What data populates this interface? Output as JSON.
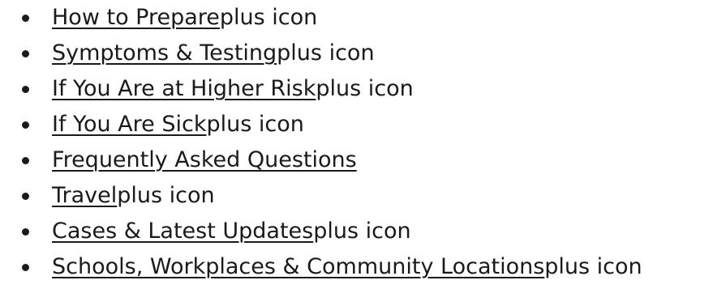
{
  "nav": {
    "items": [
      {
        "label": "How to Prepare",
        "suffix": "plus icon"
      },
      {
        "label": "Symptoms & Testing",
        "suffix": "plus icon"
      },
      {
        "label": "If You Are at Higher Risk",
        "suffix": "plus icon"
      },
      {
        "label": "If You Are Sick",
        "suffix": "plus icon"
      },
      {
        "label": "Frequently Asked Questions",
        "suffix": ""
      },
      {
        "label": "Travel",
        "suffix": "plus icon"
      },
      {
        "label": "Cases & Latest Updates",
        "suffix": "plus icon"
      },
      {
        "label": "Schools, Workplaces & Community Locations",
        "suffix": "plus icon"
      }
    ]
  }
}
